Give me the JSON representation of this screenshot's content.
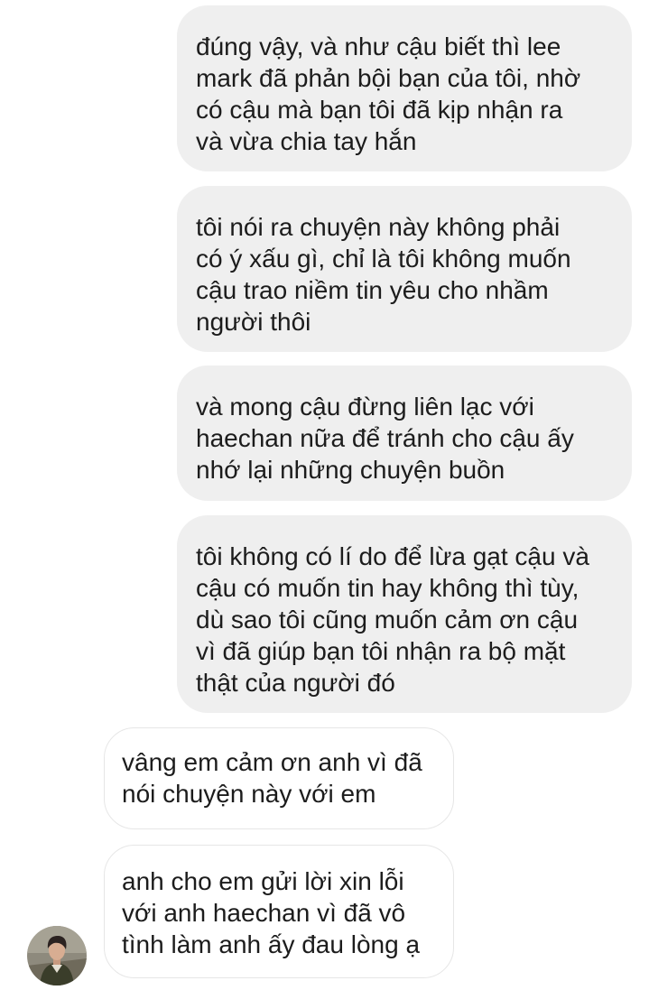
{
  "messages": [
    {
      "direction": "sent",
      "text": "đúng vậy, và như cậu biết thì lee\nmark đã phản bội bạn của tôi, nhờ\ncó cậu mà bạn tôi đã kịp nhận ra\nvà vừa chia tay hắn"
    },
    {
      "direction": "sent",
      "text": "tôi nói ra chuyện này không phải\ncó ý xấu gì, chỉ là tôi không muốn\ncậu trao niềm tin yêu cho nhầm\nngười thôi"
    },
    {
      "direction": "sent",
      "text": "và mong cậu đừng liên lạc với\nhaechan nữa để tránh cho cậu ấy\nnhớ lại những chuyện buồn"
    },
    {
      "direction": "sent",
      "text": "tôi không có lí do để lừa gạt cậu và\ncậu có muốn tin hay không thì tùy,\ndù sao tôi cũng muốn cảm ơn cậu\nvì đã giúp bạn tôi nhận ra bộ mặt\nthật của người đó"
    },
    {
      "direction": "received",
      "text": "vâng em cảm ơn anh vì đã\nnói chuyện này với em"
    },
    {
      "direction": "received",
      "text": "anh cho em gửi lời xin lỗi\nvới anh haechan vì đã vô\ntình làm anh ấy đau lòng ạ"
    }
  ],
  "colors": {
    "sent_bubble": "#efefef",
    "received_border": "#e6e6e6",
    "text": "#1c1c1c"
  },
  "icons": {
    "avatar": "contact-avatar-photo"
  }
}
